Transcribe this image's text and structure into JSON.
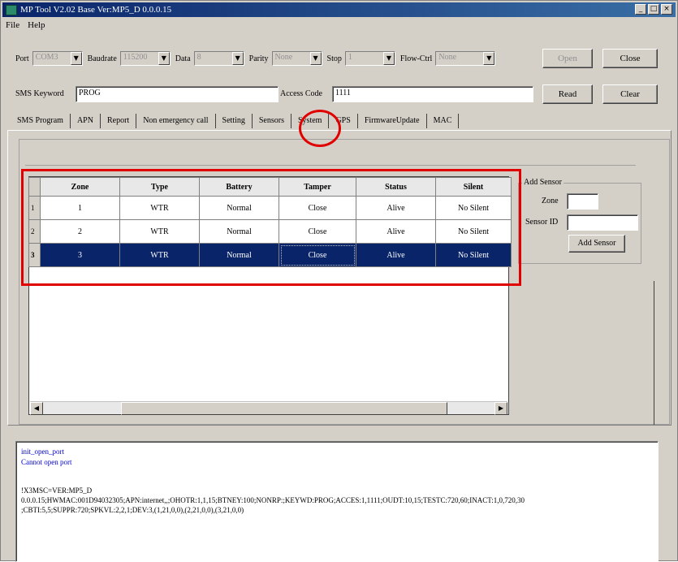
{
  "window": {
    "title": "MP Tool V2.02  Base Ver:MP5_D 0.0.0.15",
    "minimize_glyph": "_",
    "maximize_glyph": "□",
    "close_glyph": "×"
  },
  "menu": [
    "File",
    "Help"
  ],
  "connection": {
    "port_label": "Port",
    "port_value": "COM3",
    "baudrate_label": "Baudrate",
    "baudrate_value": "115200",
    "data_label": "Data",
    "data_value": "8",
    "parity_label": "Parity",
    "parity_value": "None",
    "stop_label": "Stop",
    "stop_value": "1",
    "flowctrl_label": "Flow-Ctrl",
    "flowctrl_value": "None",
    "open_button": "Open",
    "close_button": "Close"
  },
  "credentials": {
    "sms_keyword_label": "SMS Keyword",
    "sms_keyword_value": "PROG",
    "access_code_label": "Access Code",
    "access_code_value": "1111",
    "read_button": "Read",
    "clear_button": "Clear"
  },
  "tabs": [
    "SMS Program",
    "APN",
    "Report",
    "Non emergency call",
    "Setting",
    "Sensors",
    "System",
    "GPS",
    "FirmwareUpdate",
    "MAC"
  ],
  "active_tab": "Sensors",
  "sensor_table": {
    "columns": [
      "Zone",
      "Type",
      "Battery",
      "Tamper",
      "Status",
      "Silent"
    ],
    "rows": [
      {
        "index": "1",
        "zone": "1",
        "type": "WTR",
        "battery": "Normal",
        "tamper": "Close",
        "status": "Alive",
        "silent": "No Silent"
      },
      {
        "index": "2",
        "zone": "2",
        "type": "WTR",
        "battery": "Normal",
        "tamper": "Close",
        "status": "Alive",
        "silent": "No Silent"
      },
      {
        "index": "3",
        "zone": "3",
        "type": "WTR",
        "battery": "Normal",
        "tamper": "Close",
        "status": "Alive",
        "silent": "No Silent"
      }
    ],
    "selected_row": 3
  },
  "add_sensor": {
    "group_title": "Add Sensor",
    "zone_label": "Zone",
    "zone_value": "",
    "sensor_id_label": "Sensor ID",
    "sensor_id_value": "",
    "button": "Add Sensor"
  },
  "log": {
    "lines_blue": [
      "init_open_port",
      "Cannot open port"
    ],
    "lines_black": [
      "!X3MSC=VER:MP5_D",
      "0.0.0.15;HWMAC:001D94032305;APN:internet,,;OHOTR:1,1,15;BTNEY:100;NONRP:;KEYWD:PROG;ACCES:1,1111;OUDT:10,15;TESTC:720,60;INACT:1,0,720,30",
      ";CBTI:5,5;SUPPR:720;SPKVL:2,2,1;DEV:3,(1,21,0,0),(2,21,0,0),(3,21,0,0)"
    ]
  },
  "annotation_color": "#e00000",
  "selection_color": "#0a246a"
}
